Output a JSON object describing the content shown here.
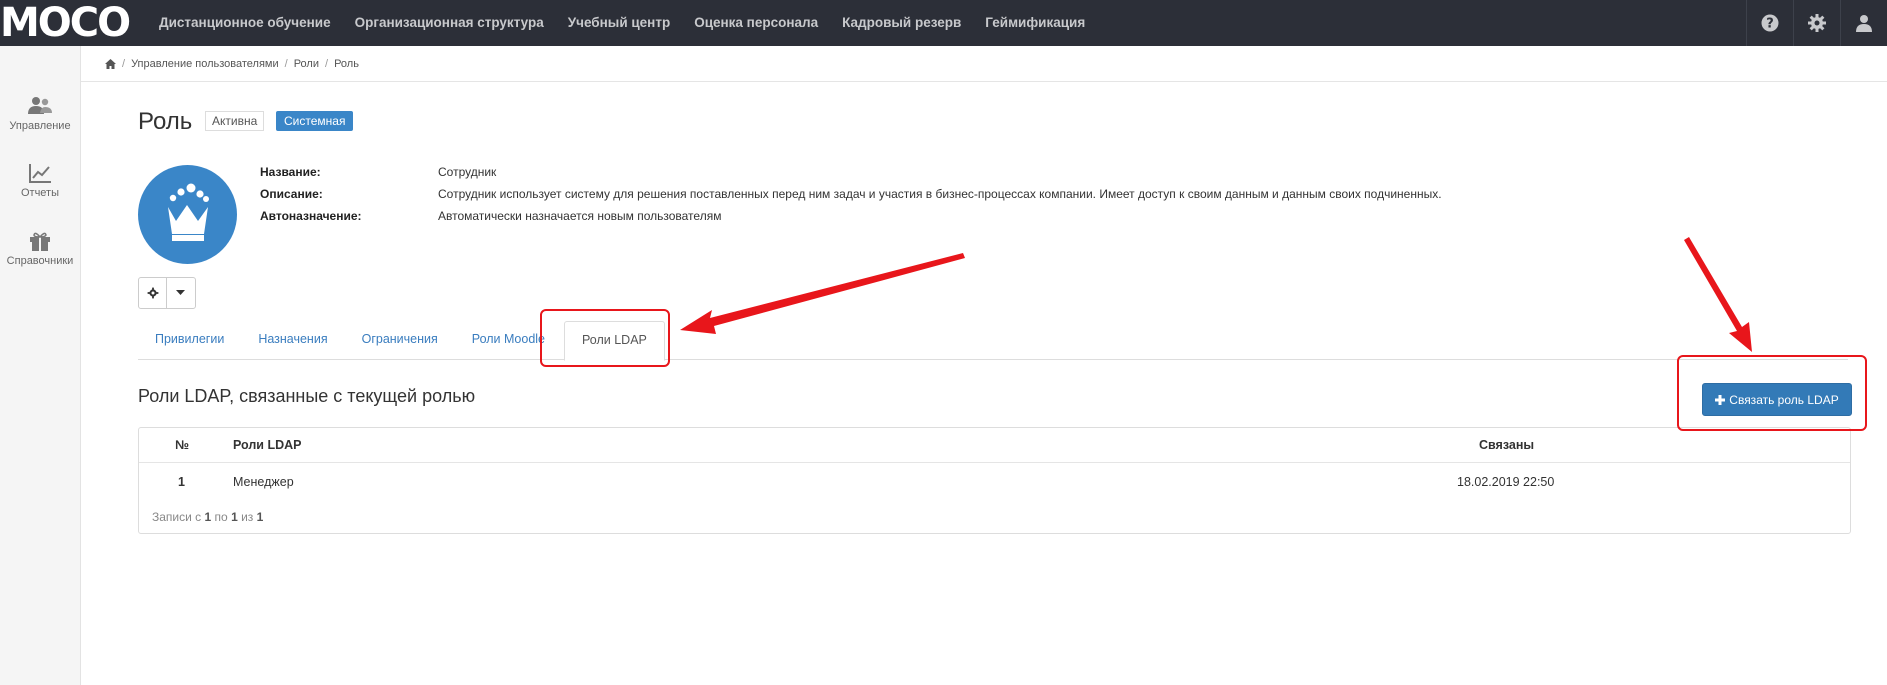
{
  "app": {
    "logo_text": "MOCO"
  },
  "topnav": {
    "items": [
      "Дистанционное обучение",
      "Организационная структура",
      "Учебный центр",
      "Оценка персонала",
      "Кадровый резерв",
      "Геймификация"
    ],
    "icons": [
      "help-icon",
      "gear-icon",
      "user-icon"
    ]
  },
  "sidebar": {
    "items": [
      {
        "label": "Управление",
        "icon": "users-icon"
      },
      {
        "label": "Отчеты",
        "icon": "chart-icon"
      },
      {
        "label": "Справочники",
        "icon": "gift-icon"
      }
    ]
  },
  "breadcrumb": {
    "home_icon": "home-icon",
    "items": [
      "Управление пользователями",
      "Роли",
      "Роль"
    ]
  },
  "page": {
    "title": "Роль",
    "status_badge": "Активна",
    "type_badge": "Системная",
    "avatar_icon": "crown-icon",
    "properties": [
      {
        "key": "Название:",
        "value": "Сотрудник"
      },
      {
        "key": "Описание:",
        "value": "Сотрудник использует систему для решения поставленных перед ним задач и участия в бизнес-процессах компании. Имеет доступ к своим данным и данным своих подчиненных."
      },
      {
        "key": "Автоназначение:",
        "value": "Автоматически назначается новым пользователям"
      }
    ]
  },
  "tabs": [
    "Привилегии",
    "Назначения",
    "Ограничения",
    "Роли Moodle",
    "Роли LDAP"
  ],
  "active_tab": "Роли LDAP",
  "section": {
    "title": "Роли LDAP, связанные с текущей ролью",
    "link_button": "Связать роль LDAP"
  },
  "table": {
    "columns": [
      "№",
      "Роли LDAP",
      "Связаны"
    ],
    "rows": [
      {
        "num": "1",
        "role": "Менеджер",
        "linked": "18.02.2019 22:50"
      }
    ],
    "footer": {
      "prefix": "Записи с",
      "from": "1",
      "to_word": "по",
      "to": "1",
      "of_word": "из",
      "total": "1"
    }
  },
  "colors": {
    "navbar": "#2c2f38",
    "accent": "#3a86c8",
    "button": "#337ab7",
    "annotation": "#e8161b"
  }
}
